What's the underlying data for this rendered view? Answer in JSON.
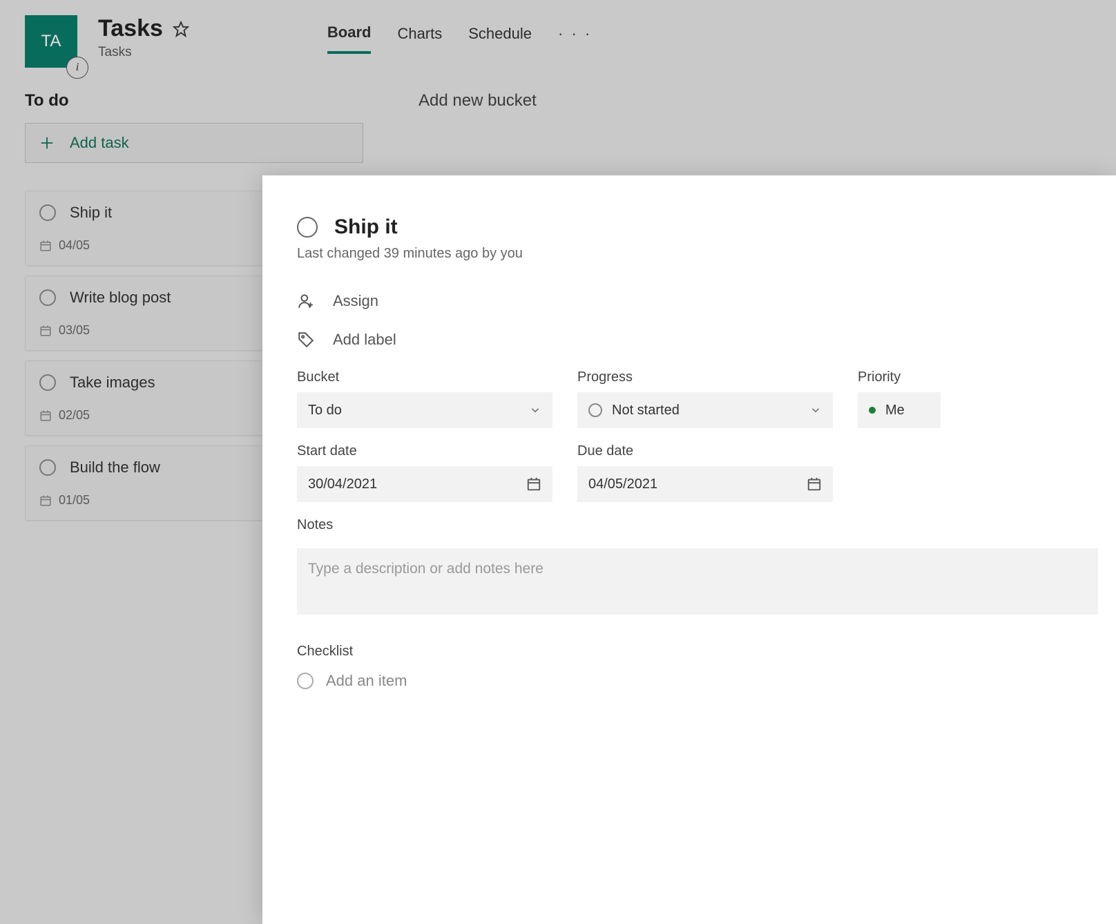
{
  "header": {
    "tile_initials": "TA",
    "title": "Tasks",
    "subtitle": "Tasks",
    "tabs": [
      "Board",
      "Charts",
      "Schedule"
    ],
    "active_tab": 0
  },
  "buckets": [
    {
      "name": "To do",
      "add_task_label": "Add task",
      "cards": [
        {
          "title": "Ship it",
          "date": "04/05"
        },
        {
          "title": "Write blog post",
          "date": "03/05"
        },
        {
          "title": "Take images",
          "date": "02/05"
        },
        {
          "title": "Build the flow",
          "date": "01/05"
        }
      ]
    }
  ],
  "add_bucket_label": "Add new bucket",
  "panel": {
    "title": "Ship it",
    "meta": "Last changed 39 minutes ago by you",
    "assign_label": "Assign",
    "add_label_label": "Add label",
    "bucket_label": "Bucket",
    "bucket_value": "To do",
    "progress_label": "Progress",
    "progress_value": "Not started",
    "priority_label": "Priority",
    "priority_value": "Me",
    "start_label": "Start date",
    "start_value": "30/04/2021",
    "due_label": "Due date",
    "due_value": "04/05/2021",
    "notes_label": "Notes",
    "notes_placeholder": "Type a description or add notes here",
    "checklist_label": "Checklist",
    "checklist_add": "Add an item"
  }
}
